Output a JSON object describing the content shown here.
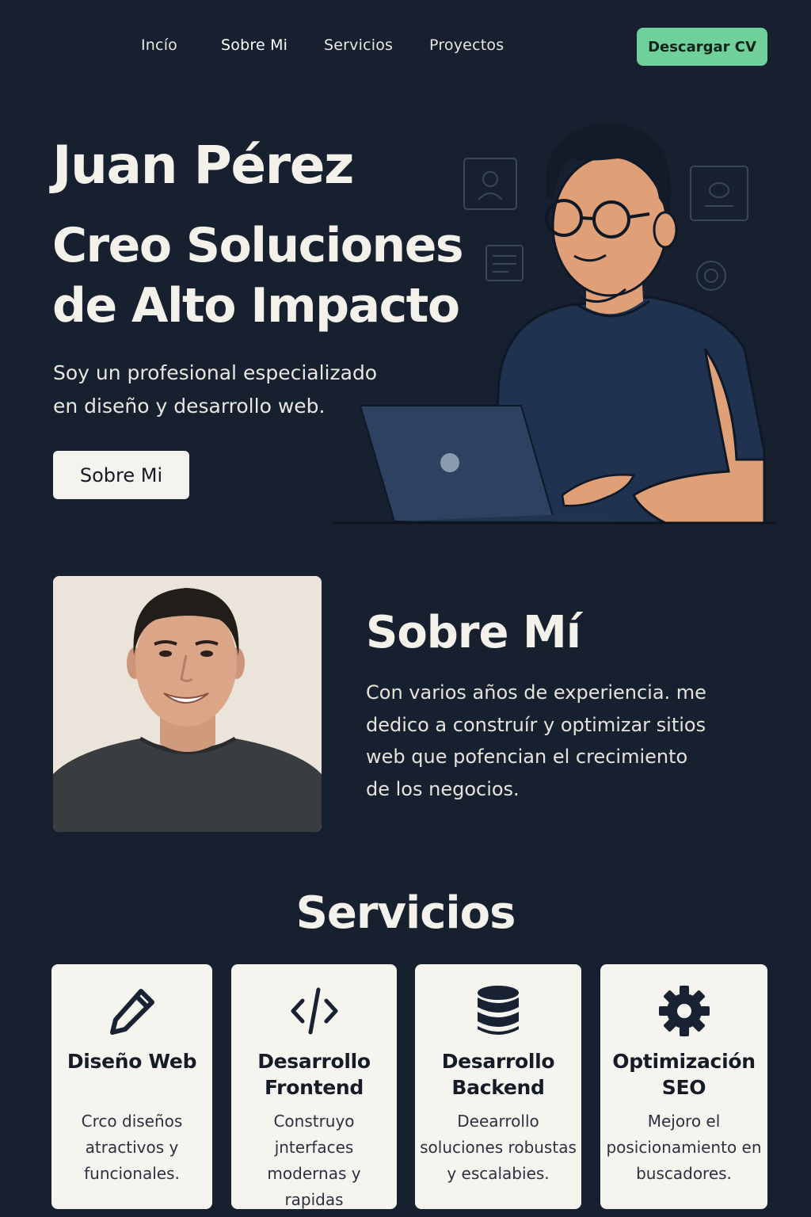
{
  "nav": {
    "items": [
      "Incío",
      "Sobre Mi",
      "Servicios",
      "Proyectos"
    ],
    "active": "Sobre Mi",
    "cta_label": "Descargar CV"
  },
  "hero": {
    "name": "Juan Pérez",
    "title": "Creo Soluciones de Alto Impacto",
    "subtitle": "Soy un profesional especializado en diseño y desarrollo web.",
    "button_label": "Sobre Mi"
  },
  "about": {
    "title": "Sobre Mí",
    "text": "Con varios años de experiencia. me dedico a construír y optimizar sitios web que pofencian el crecimiento de los negocios."
  },
  "services": {
    "title": "Servicios",
    "cards": [
      {
        "icon": "pencil-icon",
        "title": "Diseño Web",
        "desc": "Crco diseños atractivos y funcionales."
      },
      {
        "icon": "code-icon",
        "title": "Desarrollo Frontend",
        "desc": "Construyo jnterfaces modernas y rapidas"
      },
      {
        "icon": "database-icon",
        "title": "Desarrollo Backend",
        "desc": "Deearrollo soluciones robustas y escalabies."
      },
      {
        "icon": "gear-icon",
        "title": "Optimización SEO",
        "desc": "Mejoro el posicionamiento en buscadores."
      }
    ]
  },
  "colors": {
    "background": "#16202f",
    "accent": "#6fd09a",
    "card": "#f6f4ef"
  }
}
